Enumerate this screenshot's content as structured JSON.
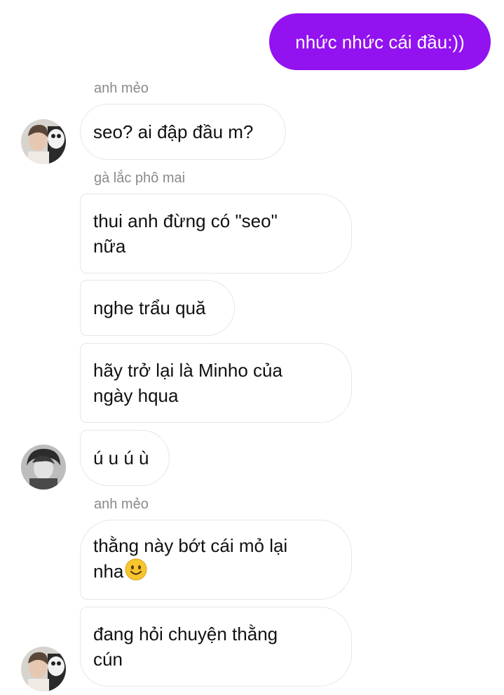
{
  "outgoing": [
    {
      "text": "nhức nhức cái đầu:))"
    }
  ],
  "senders": {
    "s1": "anh mẻo",
    "s2": "gà lắc phô mai",
    "s3": "anh mẻo"
  },
  "messages": [
    {
      "text": "seo? ai đập đầu m?"
    },
    {
      "text": "thui anh đừng có \"seo\"\nnữa"
    },
    {
      "text": "nghe trẩu quă"
    },
    {
      "text": "hãy trở lại là Minho của\nngày hqua"
    },
    {
      "text": "ú u ú ù"
    },
    {
      "text": "thằng này bớt cái mỏ lại\nnha"
    },
    {
      "text": "đang hỏi chuyện thằng\ncún"
    }
  ],
  "emoji": {
    "name": "slightly-smiling-face-icon",
    "color": "#f7c52e"
  },
  "colors": {
    "outgoing_bubble": "#9312f0",
    "incoming_border": "#e6e6e6",
    "sender_label": "#8a8a8a"
  },
  "avatars": [
    "avatar-anh-meo",
    "avatar-ga-lac-pho-mai",
    "avatar-anh-meo"
  ]
}
